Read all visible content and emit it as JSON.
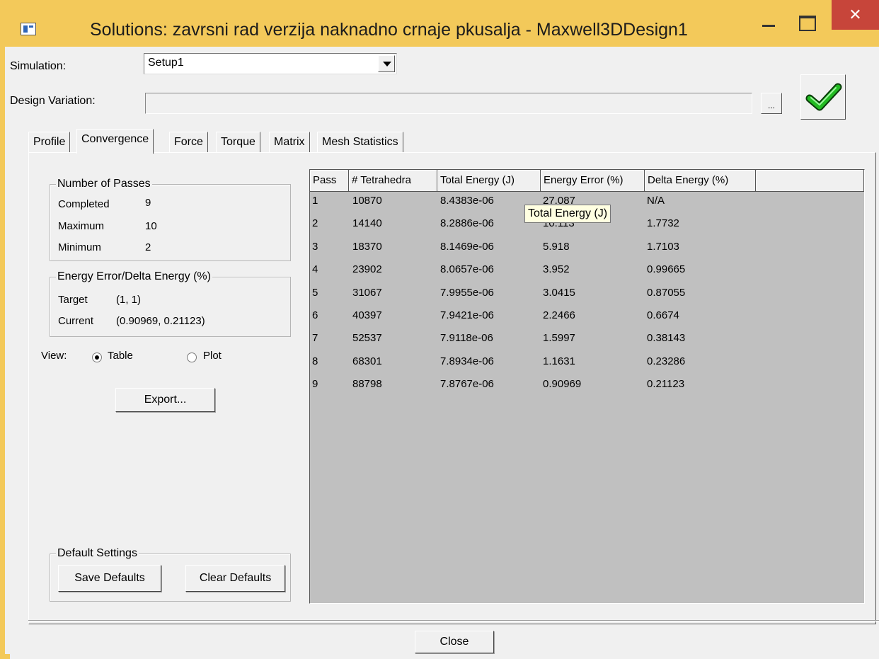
{
  "window": {
    "title": "Solutions: zavrsni rad verzija naknadno crnaje pkusalja - Maxwell3DDesign1",
    "close_glyph": "✕"
  },
  "simulation": {
    "label": "Simulation:",
    "value": "Setup1"
  },
  "design_variation": {
    "label": "Design Variation:",
    "value": "",
    "browse_label": "..."
  },
  "tabs": [
    {
      "label": "Profile"
    },
    {
      "label": "Convergence"
    },
    {
      "label": "Force"
    },
    {
      "label": "Torque"
    },
    {
      "label": "Matrix"
    },
    {
      "label": "Mesh Statistics"
    }
  ],
  "active_tab": "Convergence",
  "passes": {
    "title": "Number of Passes",
    "completed_label": "Completed",
    "completed": "9",
    "maximum_label": "Maximum",
    "maximum": "10",
    "minimum_label": "Minimum",
    "minimum": "2"
  },
  "energy": {
    "title": "Energy Error/Delta Energy (%)",
    "target_label": "Target",
    "target": "(1, 1)",
    "current_label": "Current",
    "current": "(0.90969, 0.21123)"
  },
  "view": {
    "label": "View:",
    "table_label": "Table",
    "plot_label": "Plot",
    "selected": "Table"
  },
  "export_label": "Export...",
  "defaults": {
    "title": "Default Settings",
    "save_label": "Save Defaults",
    "clear_label": "Clear Defaults"
  },
  "table": {
    "columns": [
      "Pass",
      "# Tetrahedra",
      "Total Energy (J)",
      "Energy Error (%)",
      "Delta Energy (%)"
    ],
    "rows": [
      [
        "1",
        "10870",
        "8.4383e-06",
        "27.087",
        "N/A"
      ],
      [
        "2",
        "14140",
        "8.2886e-06",
        "10.113",
        "1.7732"
      ],
      [
        "3",
        "18370",
        "8.1469e-06",
        "5.918",
        "1.7103"
      ],
      [
        "4",
        "23902",
        "8.0657e-06",
        "3.952",
        "0.99665"
      ],
      [
        "5",
        "31067",
        "7.9955e-06",
        "3.0415",
        "0.87055"
      ],
      [
        "6",
        "40397",
        "7.9421e-06",
        "2.2466",
        "0.6674"
      ],
      [
        "7",
        "52537",
        "7.9118e-06",
        "1.5997",
        "0.38143"
      ],
      [
        "8",
        "68301",
        "7.8934e-06",
        "1.1631",
        "0.23286"
      ],
      [
        "9",
        "88798",
        "7.8767e-06",
        "0.90969",
        "0.21123"
      ]
    ]
  },
  "tooltip": "Total Energy (J)",
  "close_label": "Close",
  "colors": {
    "title_bar": "#f3c95a",
    "close_button": "#c7453a",
    "grid_background": "#c0c0c0",
    "check": "#22bb22"
  }
}
